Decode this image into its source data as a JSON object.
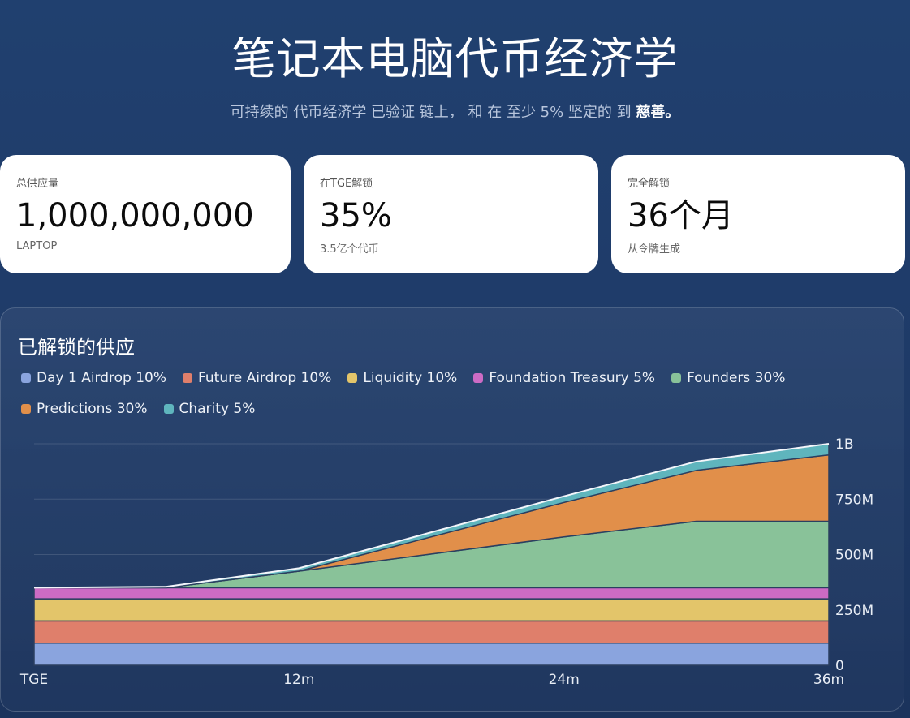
{
  "header": {
    "title": "笔记本电脑代币经济学",
    "subtitle_pre": "可持续的 代币经济学 已验证 链上， 和 在 至少 5% 坚定的 到 ",
    "subtitle_bold": "慈善。"
  },
  "cards": [
    {
      "label": "总供应量",
      "value": "1,000,000,000",
      "note": "LAPTOP"
    },
    {
      "label": "在TGE解锁",
      "value": "35%",
      "note": "3.5亿个代币"
    },
    {
      "label": "完全解锁",
      "value": "36个月",
      "note": "从令牌生成"
    }
  ],
  "panel": {
    "title": "已解锁的供应"
  },
  "chart_data": {
    "type": "area",
    "stacked": true,
    "title": "已解锁的供应",
    "x": [
      0,
      6,
      12,
      24,
      30,
      36
    ],
    "x_ticks": [
      {
        "value": 0,
        "label": "TGE"
      },
      {
        "value": 12,
        "label": "12m"
      },
      {
        "value": 24,
        "label": "24m"
      },
      {
        "value": 36,
        "label": "36m"
      }
    ],
    "y_ticks": [
      {
        "value": 0,
        "label": "0"
      },
      {
        "value": 250000000,
        "label": "250M"
      },
      {
        "value": 500000000,
        "label": "500M"
      },
      {
        "value": 750000000,
        "label": "750M"
      },
      {
        "value": 1000000000,
        "label": "1B"
      }
    ],
    "ylim": [
      0,
      1000000000
    ],
    "grid": true,
    "legend_position": "top-left",
    "series": [
      {
        "name": "Day 1 Airdrop 10%",
        "color": "#8aa4de",
        "values": [
          100000000,
          100000000,
          100000000,
          100000000,
          100000000,
          100000000
        ]
      },
      {
        "name": "Future Airdrop 10%",
        "color": "#df7f6b",
        "values": [
          100000000,
          100000000,
          100000000,
          100000000,
          100000000,
          100000000
        ]
      },
      {
        "name": "Liquidity 10%",
        "color": "#e3c56a",
        "values": [
          100000000,
          100000000,
          100000000,
          100000000,
          100000000,
          100000000
        ]
      },
      {
        "name": "Foundation Treasury 5%",
        "color": "#cc6bc4",
        "values": [
          50000000,
          50000000,
          50000000,
          50000000,
          50000000,
          50000000
        ]
      },
      {
        "name": "Founders 30%",
        "color": "#89c299",
        "values": [
          0,
          0,
          75000000,
          230000000,
          300000000,
          300000000
        ]
      },
      {
        "name": "Predictions 30%",
        "color": "#e18f4a",
        "values": [
          0,
          0,
          0,
          155000000,
          230000000,
          300000000
        ]
      },
      {
        "name": "Charity 5%",
        "color": "#5fb5bd",
        "values": [
          0,
          5000000,
          13000000,
          28000000,
          40000000,
          50000000
        ]
      }
    ]
  }
}
